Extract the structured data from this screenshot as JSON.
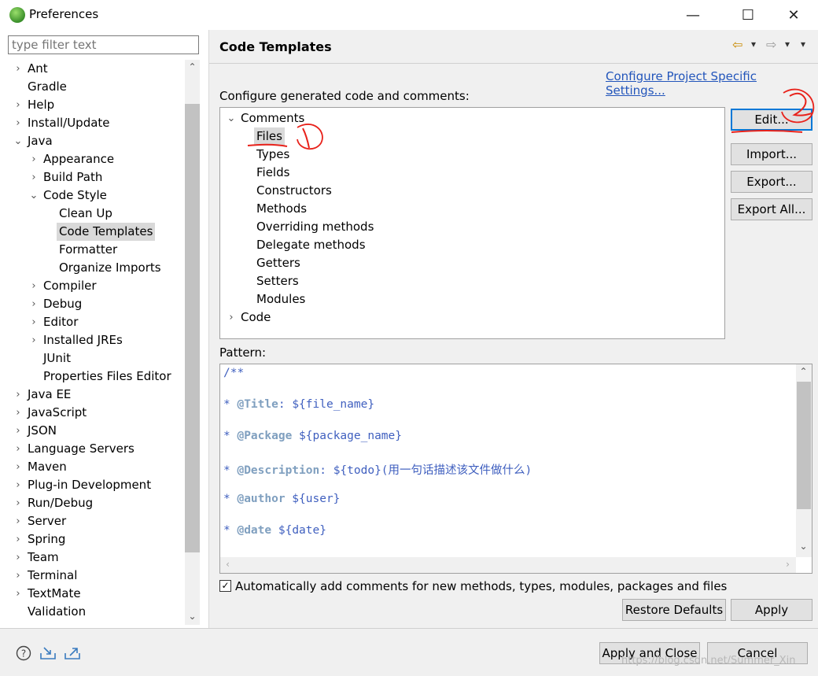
{
  "window": {
    "title": "Preferences",
    "minimize": "—",
    "maximize": "☐",
    "close": "✕"
  },
  "filter": {
    "placeholder": "type filter text"
  },
  "sidebar": {
    "items": [
      {
        "label": "Ant",
        "expander": "›"
      },
      {
        "label": "Gradle",
        "expander": ""
      },
      {
        "label": "Help",
        "expander": "›"
      },
      {
        "label": "Install/Update",
        "expander": "›"
      },
      {
        "label": "Java",
        "expander": "⌄"
      },
      {
        "label": "Appearance",
        "expander": "›"
      },
      {
        "label": "Build Path",
        "expander": "›"
      },
      {
        "label": "Code Style",
        "expander": "⌄"
      },
      {
        "label": "Clean Up",
        "expander": ""
      },
      {
        "label": "Code Templates",
        "expander": ""
      },
      {
        "label": "Formatter",
        "expander": ""
      },
      {
        "label": "Organize Imports",
        "expander": ""
      },
      {
        "label": "Compiler",
        "expander": "›"
      },
      {
        "label": "Debug",
        "expander": "›"
      },
      {
        "label": "Editor",
        "expander": "›"
      },
      {
        "label": "Installed JREs",
        "expander": "›"
      },
      {
        "label": "JUnit",
        "expander": ""
      },
      {
        "label": "Properties Files Editor",
        "expander": ""
      },
      {
        "label": "Java EE",
        "expander": "›"
      },
      {
        "label": "JavaScript",
        "expander": "›"
      },
      {
        "label": "JSON",
        "expander": "›"
      },
      {
        "label": "Language Servers",
        "expander": "›"
      },
      {
        "label": "Maven",
        "expander": "›"
      },
      {
        "label": "Plug-in Development",
        "expander": "›"
      },
      {
        "label": "Run/Debug",
        "expander": "›"
      },
      {
        "label": "Server",
        "expander": "›"
      },
      {
        "label": "Spring",
        "expander": "›"
      },
      {
        "label": "Team",
        "expander": "›"
      },
      {
        "label": "Terminal",
        "expander": "›"
      },
      {
        "label": "TextMate",
        "expander": "›"
      },
      {
        "label": "Validation",
        "expander": ""
      }
    ],
    "scroll_up": "⌃",
    "scroll_down": "⌄"
  },
  "main": {
    "title": "Code Templates",
    "nav_back": "⇦",
    "nav_forward": "⇨",
    "nav_menu": "▾",
    "view_menu": "▾",
    "configure_link": "Configure Project Specific Settings...",
    "configure_label": "Configure generated code and comments:",
    "templates": [
      {
        "label": "Comments",
        "expander": "⌄"
      },
      {
        "label": "Files",
        "expander": ""
      },
      {
        "label": "Types",
        "expander": ""
      },
      {
        "label": "Fields",
        "expander": ""
      },
      {
        "label": "Constructors",
        "expander": ""
      },
      {
        "label": "Methods",
        "expander": ""
      },
      {
        "label": "Overriding methods",
        "expander": ""
      },
      {
        "label": "Delegate methods",
        "expander": ""
      },
      {
        "label": "Getters",
        "expander": ""
      },
      {
        "label": "Setters",
        "expander": ""
      },
      {
        "label": "Modules",
        "expander": ""
      },
      {
        "label": "Code",
        "expander": "›"
      }
    ],
    "buttons": {
      "edit": "Edit...",
      "import": "Import...",
      "export": "Export...",
      "export_all": "Export All..."
    },
    "pattern_label": "Pattern:",
    "pattern_lines": [
      {
        "prefix": "/**",
        "tag": "",
        "rest": ""
      },
      {
        "prefix": "* ",
        "tag": "@Title",
        "rest": ": ${file_name}"
      },
      {
        "prefix": "* ",
        "tag": "@Package",
        "rest": " ${package_name}"
      },
      {
        "prefix": "* ",
        "tag": "@Description",
        "rest": ": ${todo}(用一句话描述该文件做什么)"
      },
      {
        "prefix": "* ",
        "tag": "@author",
        "rest": " ${user}"
      },
      {
        "prefix": "* ",
        "tag": "@date",
        "rest": " ${date}"
      }
    ],
    "auto_comment_label": "Automatically add comments for new methods, types, modules, packages and files",
    "auto_comment_checked": true,
    "restore_defaults": "Restore Defaults",
    "apply": "Apply"
  },
  "footer": {
    "apply_close": "Apply and Close",
    "cancel": "Cancel",
    "help_icon": "help-icon",
    "import_icon": "import-prefs-icon",
    "export_icon": "export-prefs-icon"
  },
  "annotations": {
    "mark1": "1",
    "mark2": "2"
  },
  "watermark": "https://blog.csdn.net/Summer_Xin",
  "colors": {
    "accent": "#0078d7",
    "link": "#2255bb",
    "annotation": "#e8221b",
    "selection": "#d9d9d9"
  }
}
